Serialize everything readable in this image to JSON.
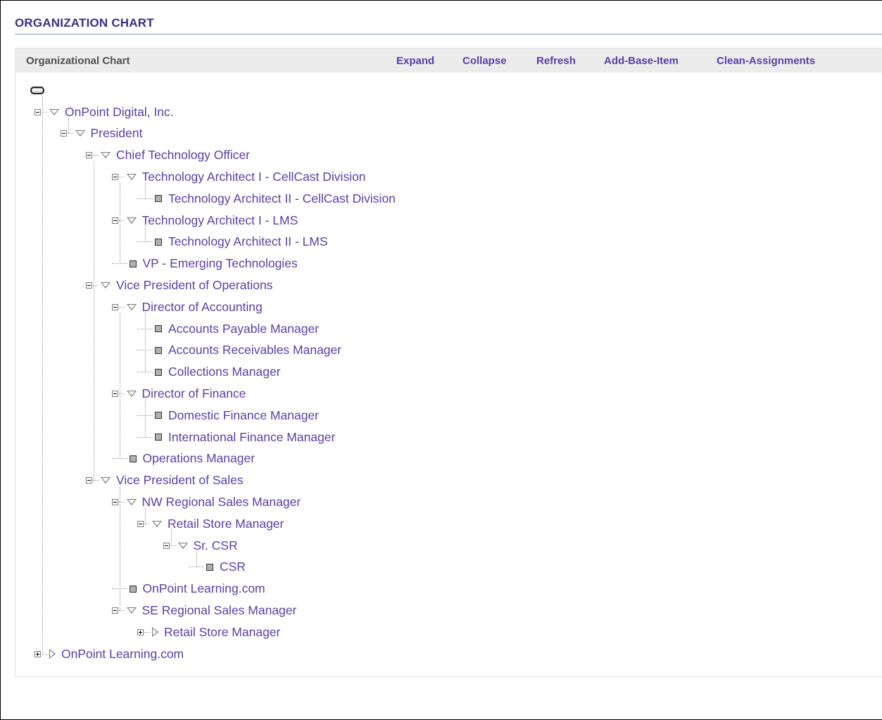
{
  "page_title": "ORGANIZATION CHART",
  "toolbar": {
    "title": "Organizational Chart",
    "actions": [
      "Expand",
      "Collapse",
      "Refresh",
      "Add-Base-Item",
      "Clean-Assignments"
    ]
  },
  "tree": [
    {
      "label": "OnPoint Digital, Inc.",
      "state": "expanded"
    },
    {
      "label": "President",
      "state": "expanded"
    },
    {
      "label": "Chief Technology Officer",
      "state": "expanded"
    },
    {
      "label": "Technology Architect I - CellCast Division",
      "state": "expanded"
    },
    {
      "label": "Technology Architect II - CellCast Division",
      "state": "leaf"
    },
    {
      "label": "Technology Architect I - LMS",
      "state": "expanded"
    },
    {
      "label": "Technology Architect II - LMS",
      "state": "leaf"
    },
    {
      "label": "VP - Emerging Technologies",
      "state": "leaf"
    },
    {
      "label": "Vice President of Operations",
      "state": "expanded"
    },
    {
      "label": "Director of Accounting",
      "state": "expanded"
    },
    {
      "label": "Accounts Payable Manager",
      "state": "leaf"
    },
    {
      "label": "Accounts Receivables Manager",
      "state": "leaf"
    },
    {
      "label": "Collections Manager",
      "state": "leaf"
    },
    {
      "label": "Director of Finance",
      "state": "expanded"
    },
    {
      "label": "Domestic Finance Manager",
      "state": "leaf"
    },
    {
      "label": "International Finance Manager",
      "state": "leaf"
    },
    {
      "label": "Operations Manager",
      "state": "leaf"
    },
    {
      "label": "Vice President of Sales",
      "state": "expanded"
    },
    {
      "label": "NW Regional Sales Manager",
      "state": "expanded"
    },
    {
      "label": "Retail Store Manager",
      "state": "expanded"
    },
    {
      "label": "Sr. CSR",
      "state": "expanded"
    },
    {
      "label": "CSR",
      "state": "leaf"
    },
    {
      "label": "OnPoint Learning.com",
      "state": "leaf"
    },
    {
      "label": "SE Regional Sales Manager",
      "state": "expanded"
    },
    {
      "label": "Retail Store Manager",
      "state": "collapsed"
    },
    {
      "label": "OnPoint Learning.com",
      "state": "collapsed"
    }
  ],
  "colors": {
    "link": "#5b3fa8",
    "title": "#3a2f86",
    "toolbar_bg": "#ebebeb",
    "rule": "#7fa2cf"
  },
  "icons": {
    "root": "drive-icon",
    "expanded": "collapse-minus-icon",
    "collapsed": "expand-plus-icon",
    "leaf": "leaf-square-icon"
  }
}
